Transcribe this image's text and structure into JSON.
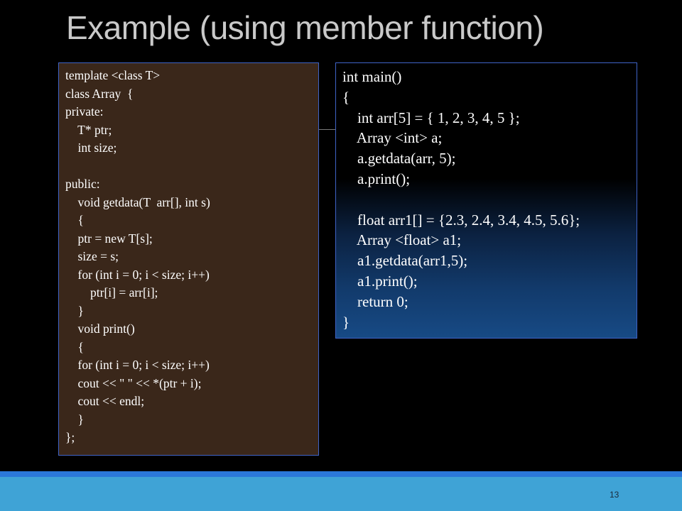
{
  "title": "Example (using member function)",
  "left_code": [
    "template <class T>",
    "class Array  {",
    "private:",
    "    T* ptr;",
    "    int size;",
    "",
    "public:",
    "    void getdata(T  arr[], int s)",
    "    {",
    "    ptr = new T[s];",
    "    size = s;",
    "    for (int i = 0; i < size; i++)",
    "        ptr[i] = arr[i];",
    "    }",
    "    void print()",
    "    {",
    "    for (int i = 0; i < size; i++)",
    "    cout << \" \" << *(ptr + i);",
    "    cout << endl;",
    "    }",
    "};"
  ],
  "right_code": [
    "int main()",
    "{",
    "    int arr[5] = { 1, 2, 3, 4, 5 };",
    "    Array <int> a;",
    "    a.getdata(arr, 5);",
    "    a.print();",
    "",
    "    float arr1[] = {2.3, 2.4, 3.4, 4.5, 5.6};",
    "    Array <float> a1;",
    "    a1.getdata(arr1,5);",
    "    a1.print();",
    "    return 0;",
    "}"
  ],
  "page_number": "13",
  "colors": {
    "background": "#000000",
    "left_box": "#3a271a",
    "box_border": "#3f63c7",
    "footer_bar": "#3fa3d6",
    "footer_accent": "#2b78d9"
  }
}
